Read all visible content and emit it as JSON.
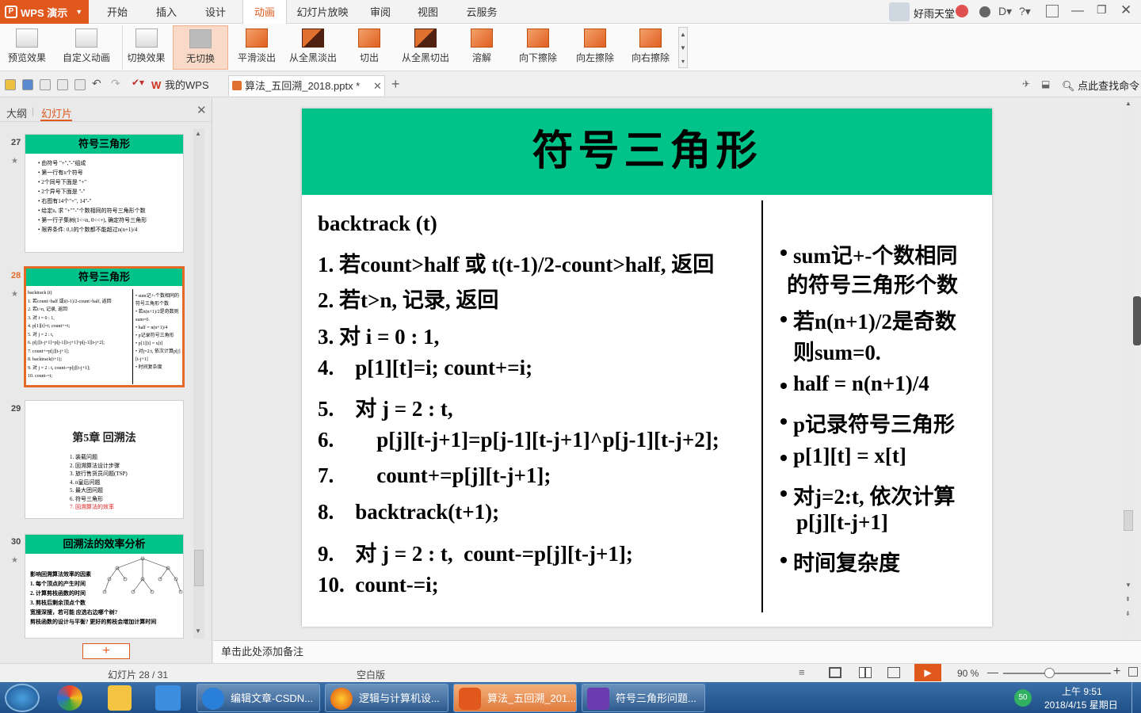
{
  "app": {
    "name": "WPS 演示",
    "user": "好雨天堂"
  },
  "menus": [
    "开始",
    "插入",
    "设计",
    "动画",
    "幻灯片放映",
    "审阅",
    "视图",
    "云服务"
  ],
  "active_menu": "动画",
  "ribbon": {
    "preview": "预览效果",
    "custom": "自定义动画",
    "switch": "切换效果",
    "items": [
      "无切换",
      "平滑淡出",
      "从全黑淡出",
      "切出",
      "从全黑切出",
      "溶解",
      "向下擦除",
      "向左擦除",
      "向右擦除"
    ]
  },
  "tabs": {
    "home": "我的WPS",
    "doc": "算法_五回溯_2018.pptx *",
    "search": "点此查找命令"
  },
  "panel": {
    "outline": "大纲",
    "slides": "幻灯片"
  },
  "thumbs": [
    {
      "num": "27",
      "title": "符号三角形",
      "lines": [
        "• 由符号 \"+\",\"-\"组成",
        "• 第一行有n个符号",
        "• 2个同号下面是 \"+\"",
        "• 2个异号下面是 \"-\"",
        "• 右图有14个\"+\", 14\"-\"",
        "• 给定n, 求 \"+\"\"-\"个数相同的符号三角形个数",
        "• 第一行子集树(1<<n, 0<<+), 确定符号三角形",
        "• 限界条件: 0,1的个数都不能超过n(n+1)/4"
      ]
    },
    {
      "num": "28",
      "title": "符号三角形",
      "lines": [
        "backtrack (t)",
        "1. 若count>half 或t(t-1)/2-count>half, 返回",
        "2. 若t>n, 记录, 返回",
        "3. 对 i = 0 : 1,",
        "4.   p[1][t]=i; count+=i;",
        "5.   对 j = 2 : t,",
        "6.      p[j][t-j+1]=p[j-1][t-j+1]^p[j-1][t-j+2];",
        "7.      count+=p[j][t-j+1];",
        "8.   backtrack(t+1);",
        "9.   对 j = 2 : t, count-=p[j][t-j+1];",
        "10. count-=i;"
      ],
      "notes": [
        "• sum记+-个数相同的符号三角形个数",
        "• 若n(n+1)/2是奇数则sum=0.",
        "• half = n(n+1)/4",
        "• p记录符号三角形",
        "• p[1][t] = x[t]",
        "• 对j=2:t, 依次计算p[j][t-j+1]",
        "• 时间复杂度"
      ]
    },
    {
      "num": "29",
      "title": "第5章 回溯法",
      "lines": [
        "1. 装载问题",
        "2. 回溯算法设计步骤",
        "3. 旅行售货员问题(TSP)",
        "4. n皇后问题",
        "5. 最大团问题",
        "6. 符号三角形",
        "7. 回溯算法的效率"
      ]
    },
    {
      "num": "30",
      "title": "回溯法的效率分析",
      "lines": [
        "影响回溯算法效率的因素",
        "1. 每个顶点的产生时间",
        "2. 计算剪枝函数的时间",
        "3. 剪枝后剩余顶点个数",
        "宽搜深搜，若可能 应选右边哪个树?",
        "剪枝函数的设计与平衡? 更好的剪枝会增加计算时间"
      ]
    }
  ],
  "slide": {
    "title": "符号三角形",
    "code": [
      "backtrack (t)",
      "1. 若count>half 或 t(t-1)/2-count>half, 返回",
      "2. 若t>n, 记录, 返回",
      "3. 对 i = 0 : 1,",
      "4.    p[1][t]=i; count+=i;",
      "5.    对 j = 2 : t,",
      "6.        p[j][t-j+1]=p[j-1][t-j+1]^p[j-1][t-j+2];",
      "7.        count+=p[j][t-j+1];",
      "8.    backtrack(t+1);",
      "9.    对 j = 2 : t,  count-=p[j][t-j+1];",
      "10.  count-=i;"
    ],
    "notes": [
      "sum记+-个数相同",
      "的符号三角形个数",
      "若n(n+1)/2是奇数",
      "则sum=0.",
      "half = n(n+1)/4",
      "p记录符号三角形",
      "p[1][t] = x[t]",
      "对j=2:t, 依次计算",
      "p[j][t-j+1]",
      "时间复杂度"
    ]
  },
  "notes_placeholder": "单击此处添加备注",
  "status": {
    "slide": "幻灯片 28 / 31",
    "template": "空白版",
    "zoom": "90 %"
  },
  "taskbar": {
    "items": [
      "编辑文章-CSDN...",
      "逻辑与计算机设...",
      "算法_五回溯_201...",
      "符号三角形问题..."
    ],
    "time": "上午 9:51",
    "date": "2018/4/15 星期日",
    "badge": "50"
  },
  "colors": {
    "accent": "#e0581c",
    "slide_header": "#00c38a",
    "selected_thumb": "#e46a2a"
  }
}
